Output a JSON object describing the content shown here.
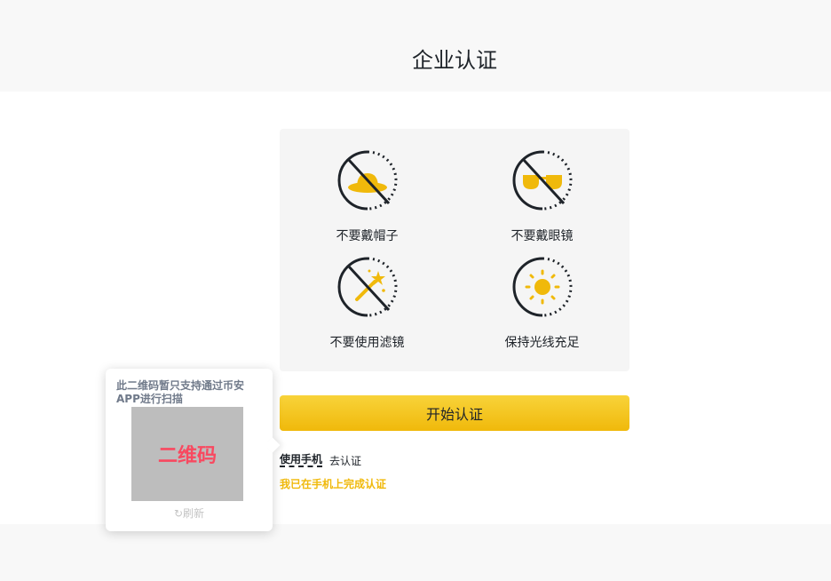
{
  "header": {
    "title": "企业认证"
  },
  "tips": [
    {
      "label": "不要戴帽子",
      "icon": "no-hat-icon"
    },
    {
      "label": "不要戴眼镜",
      "icon": "no-glasses-icon"
    },
    {
      "label": "不要使用滤镜",
      "icon": "no-filter-icon"
    },
    {
      "label": "保持光线充足",
      "icon": "sun-icon"
    }
  ],
  "actions": {
    "start_label": "开始认证",
    "use_phone_label": "使用手机",
    "use_phone_suffix": "去认证",
    "done_label": "我已在手机上完成认证"
  },
  "qr_popup": {
    "note": "此二维码暂只支持通过币安APP进行扫描",
    "placeholder": "二维码",
    "refresh_label": "刷新",
    "refresh_icon": "refresh-icon"
  },
  "colors": {
    "accent": "#F0B90B",
    "accent_light": "#F8D33A",
    "text_primary": "#1E2329",
    "qr_placeholder_text": "#F84960",
    "card_bg": "#F5F5F5",
    "header_bg": "#F8F8F8"
  }
}
